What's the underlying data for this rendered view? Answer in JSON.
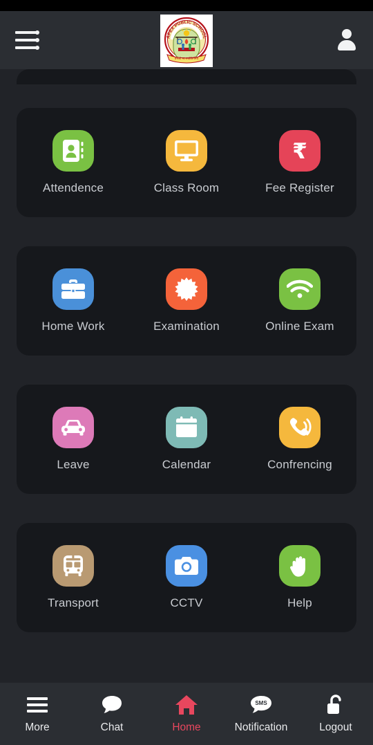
{
  "app": {
    "header": {
      "menu_label": "Menu",
      "logo_alt": "APEX PUBLIC SCHOOL",
      "logo_text_top": "APEX PUBLIC SCHOOL",
      "logo_text_bottom": "तमसो मा ज्योतिर्गमय",
      "profile_label": "Profile"
    }
  },
  "grid": {
    "rows": [
      {
        "items": [
          {
            "label": "Attendence",
            "icon": "contact-book-icon",
            "color": "#7ac143"
          },
          {
            "label": "Class Room",
            "icon": "monitor-icon",
            "color": "#f5b83d"
          },
          {
            "label": "Fee Register",
            "icon": "rupee-icon",
            "color": "#e54458"
          }
        ]
      },
      {
        "items": [
          {
            "label": "Home Work",
            "icon": "briefcase-icon",
            "color": "#4a90d9"
          },
          {
            "label": "Examination",
            "icon": "starburst-badge-icon",
            "color": "#f4633a"
          },
          {
            "label": "Online Exam",
            "icon": "wifi-icon",
            "color": "#7ac143"
          }
        ]
      },
      {
        "items": [
          {
            "label": "Leave",
            "icon": "car-icon",
            "color": "#dd7ab8"
          },
          {
            "label": "Calendar",
            "icon": "calendar-icon",
            "color": "#7ebab5"
          },
          {
            "label": "Confrencing",
            "icon": "phone-waves-icon",
            "color": "#f5b83d"
          }
        ]
      },
      {
        "items": [
          {
            "label": "Transport",
            "icon": "bus-icon",
            "color": "#b99a72"
          },
          {
            "label": "CCTV",
            "icon": "camera-icon",
            "color": "#4a90e2"
          },
          {
            "label": "Help",
            "icon": "hand-icon",
            "color": "#7ac143"
          }
        ]
      }
    ]
  },
  "bottom_nav": {
    "active": "Home",
    "accent": "#e8475e",
    "items": [
      {
        "label": "More",
        "icon": "hamburger-icon"
      },
      {
        "label": "Chat",
        "icon": "chat-bubble-icon"
      },
      {
        "label": "Home",
        "icon": "home-icon"
      },
      {
        "label": "Notification",
        "icon": "sms-bubble-icon"
      },
      {
        "label": "Logout",
        "icon": "unlock-icon"
      }
    ]
  },
  "colors": {
    "page_background": "#212328",
    "card_background": "#16181c",
    "appbar_background": "#2b2e33",
    "statusbar_background": "#000000",
    "label_text": "#c9ccd1",
    "accent_red": "#e8475e"
  }
}
